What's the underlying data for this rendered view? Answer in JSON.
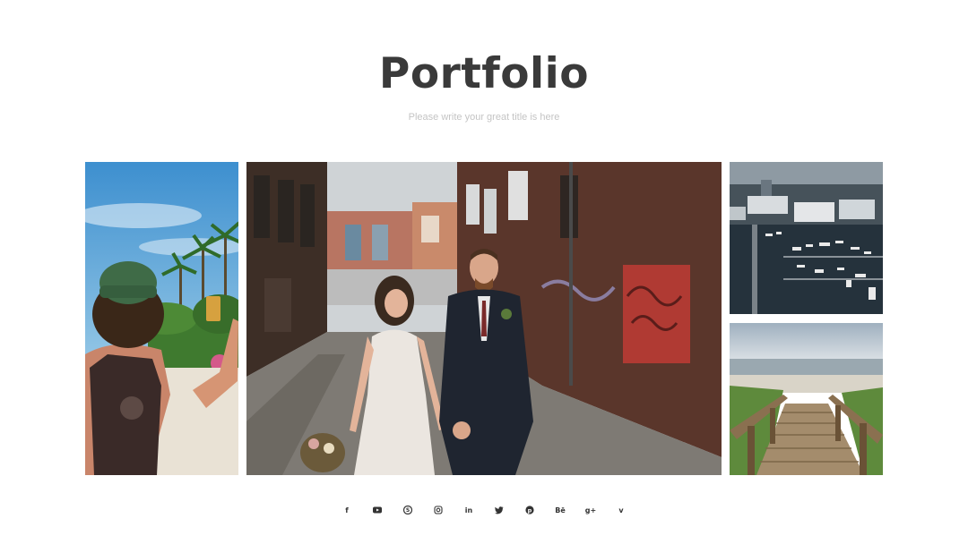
{
  "header": {
    "title": "Portfolio",
    "subtitle": "Please write your great title is here"
  },
  "gallery": {
    "photos": [
      {
        "name": "traveler-photo",
        "description": "person with green cap on tropical beach"
      },
      {
        "name": "couple-photo",
        "description": "wedding couple in brick alley"
      },
      {
        "name": "harbor-photo",
        "description": "aerial view of marina"
      },
      {
        "name": "beach-photo",
        "description": "wooden boardwalk to beach"
      }
    ]
  },
  "social": {
    "icons": [
      {
        "name": "facebook-icon",
        "glyph": "f"
      },
      {
        "name": "youtube-icon",
        "glyph": "▶"
      },
      {
        "name": "skype-icon",
        "glyph": "S"
      },
      {
        "name": "instagram-icon",
        "glyph": "◎"
      },
      {
        "name": "linkedin-icon",
        "glyph": "in"
      },
      {
        "name": "twitter-icon",
        "glyph": "t"
      },
      {
        "name": "pinterest-icon",
        "glyph": "P"
      },
      {
        "name": "behance-icon",
        "glyph": "Bē"
      },
      {
        "name": "google-plus-icon",
        "glyph": "g+"
      },
      {
        "name": "vimeo-icon",
        "glyph": "v"
      }
    ]
  },
  "colors": {
    "title": "#3a3a3a",
    "subtitle": "#c4c4c4",
    "icon": "#333333"
  }
}
